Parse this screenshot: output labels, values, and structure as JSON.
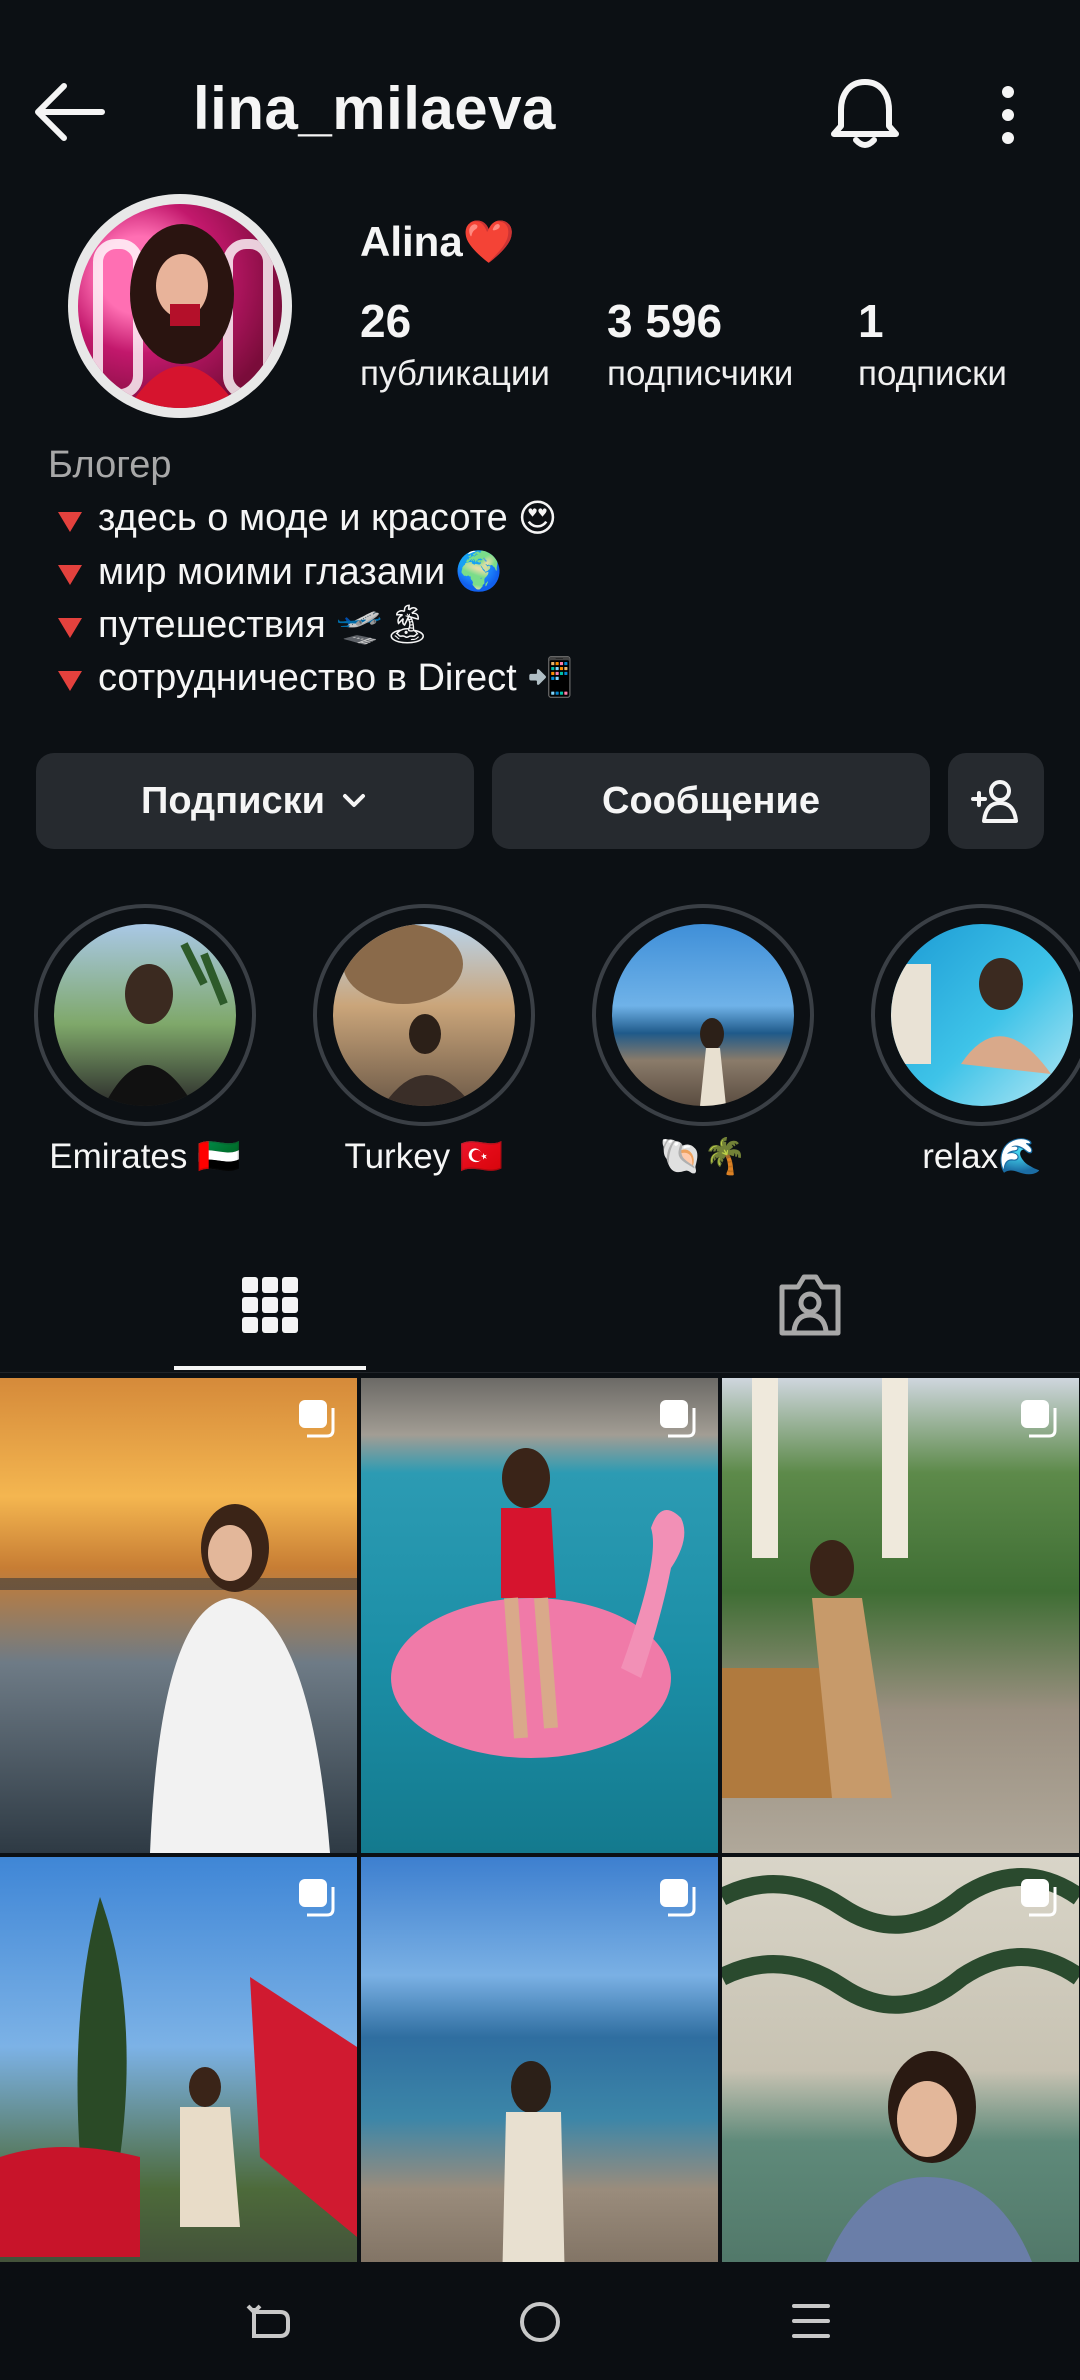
{
  "header": {
    "username": "lina_milaeva",
    "back_icon": "arrow-left-icon",
    "bell_icon": "bell-icon",
    "more_icon": "more-vertical-icon"
  },
  "profile": {
    "display_name": "Alina❤️",
    "stats": [
      {
        "value": "26",
        "label": "публикации"
      },
      {
        "value": "3 596",
        "label": "подписчики"
      },
      {
        "value": "1",
        "label": "подписки"
      }
    ],
    "category": "Блогер",
    "bio": [
      {
        "text": "здесь о моде и красоте",
        "emoji": "😍"
      },
      {
        "text": "мир моими глазами",
        "emoji": "🌍"
      },
      {
        "text": "путешествия",
        "emoji": "🛫🏝"
      },
      {
        "text": "сотрудничество в Direct",
        "emoji": "📲"
      }
    ]
  },
  "actions": {
    "following_label": "Подписки",
    "message_label": "Сообщение",
    "add_user_icon": "add-user-icon"
  },
  "highlights": [
    {
      "label": "Emirates 🇦🇪"
    },
    {
      "label": "Turkey 🇹🇷"
    },
    {
      "label": "🐚🌴"
    },
    {
      "label": "relax🌊"
    }
  ],
  "tabs": {
    "grid_icon": "grid-icon",
    "tagged_icon": "tagged-person-icon"
  },
  "colors": {
    "background": "#0c1014",
    "button": "#262a2f",
    "accent_red": "#e4413d"
  }
}
